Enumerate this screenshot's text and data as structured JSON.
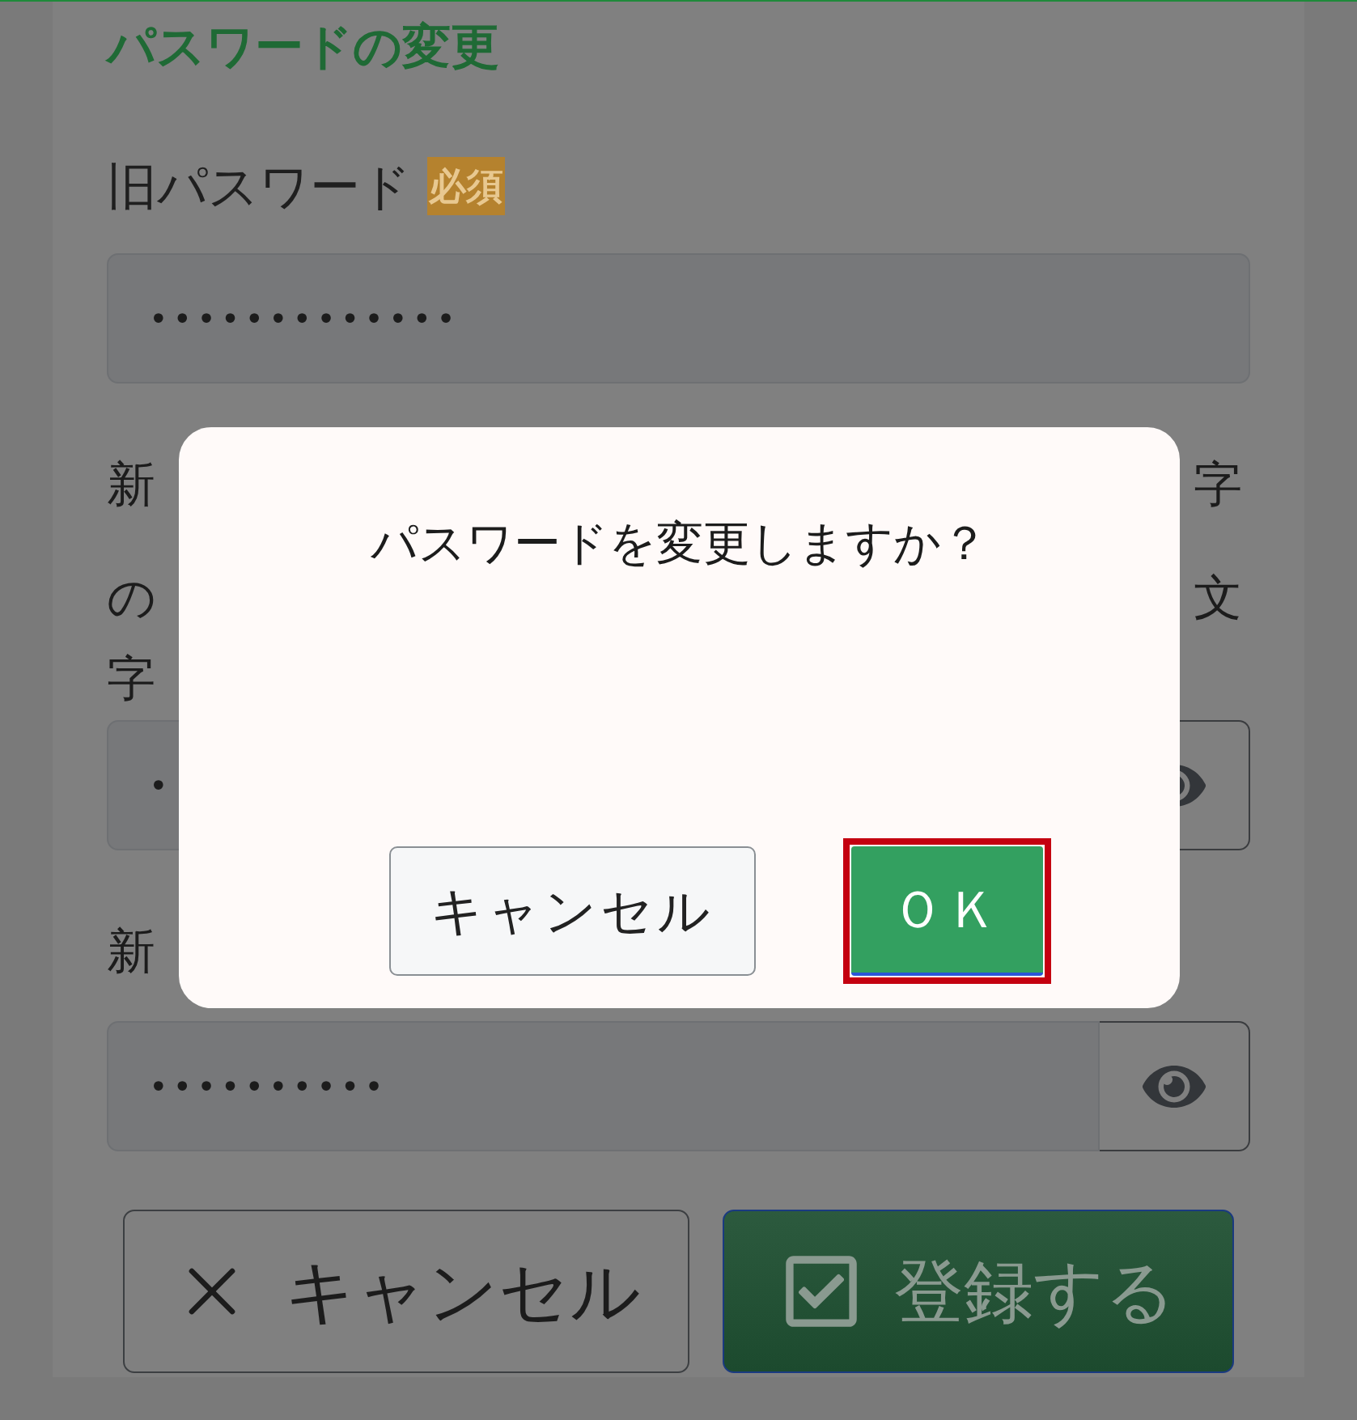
{
  "page": {
    "title": "パスワードの変更"
  },
  "old_password": {
    "label": "旧パスワード",
    "badge": "必須",
    "value": "•••••••••••••"
  },
  "new_password": {
    "label_fragments": [
      {
        "left": "新",
        "right": "字"
      },
      {
        "left": "の",
        "right": "文"
      },
      {
        "left": "字"
      }
    ],
    "value": "•"
  },
  "confirm_password": {
    "label_fragment": "新",
    "value": "••••••••••"
  },
  "buttons": [
    {
      "kind": "cancel",
      "label": "キャンセル"
    },
    {
      "kind": "submit",
      "label": "登録する"
    }
  ],
  "dialog": {
    "message": "パスワードを変更しますか？",
    "buttons": [
      {
        "kind": "cancel",
        "label": "キャンセル",
        "highlighted": false
      },
      {
        "kind": "ok",
        "label": "ＯＫ",
        "highlighted": true
      }
    ]
  }
}
